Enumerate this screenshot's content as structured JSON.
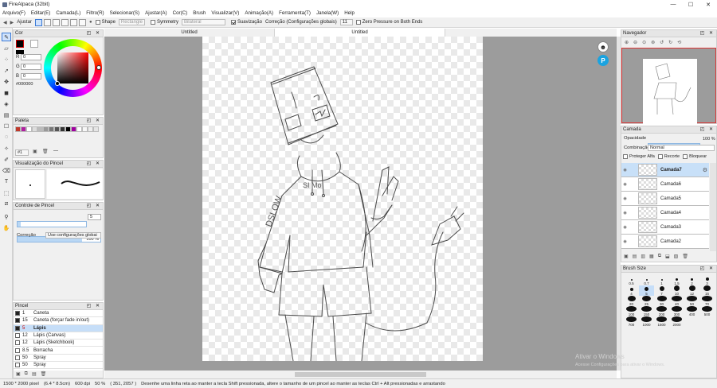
{
  "app": {
    "title": "FireAlpaca (32bit)"
  },
  "window_controls": {
    "minimize": "—",
    "maximize": "☐",
    "close": "✕"
  },
  "menu": [
    "Arquivo(F)",
    "Editar(E)",
    "Camada(L)",
    "Filtro(R)",
    "Selecionar(S)",
    "Ajustar(A)",
    "Cor(C)",
    "Brush",
    "Visualizar(V)",
    "Animação(A)",
    "Ferramenta(T)",
    "Janela(W)",
    "Help"
  ],
  "toolbar": {
    "fit_label": "Ajustar",
    "shape_label": "Shape",
    "shape_value": "Rectangle",
    "symmetry_label": "Symmetry",
    "symmetry_value": "Bilateral",
    "stabilizer_label": "Suavização",
    "correction_label": "Correção (Configurações globais)",
    "correction_value": "11",
    "zero_pressure_label": "Zero Pressure on Both Ends"
  },
  "tabs": [
    "Untitled",
    "Untitled"
  ],
  "color_panel": {
    "title": "Cor",
    "r_label": "R",
    "r": "0",
    "g_label": "G",
    "g": "0",
    "b_label": "B",
    "b": "0",
    "hex": "#000000"
  },
  "palette_panel": {
    "title": "Paleta",
    "page": "#1",
    "dash": "—",
    "colors": [
      "#c0392b",
      "#b020a0",
      "#ffffff",
      "#dddddd",
      "#bbbbbb",
      "#999999",
      "#777777",
      "#555555",
      "#333333",
      "#000000",
      "#a000a0",
      "#ffffff",
      "#f7f7f7",
      "#eeeeee",
      "#e5e5e5"
    ]
  },
  "brush_preview_panel": {
    "title": "Visualização do Pincel"
  },
  "brush_control_panel": {
    "title": "Controle de Pincel",
    "size": "5",
    "opacity": "100 %",
    "correction_label": "Correção",
    "correction_value": "Use configurações globai"
  },
  "brush_panel": {
    "title": "Pincel",
    "items": [
      {
        "size": "1",
        "name": "Caneta",
        "color": "#222222"
      },
      {
        "size": "15",
        "name": "Caneta (forçar fade in/out)",
        "color": "#222222"
      },
      {
        "size": "5",
        "name": "Lápis",
        "color": "#222222"
      },
      {
        "size": "12",
        "name": "Lápis (Canvas)",
        "color": "#ffffff"
      },
      {
        "size": "12",
        "name": "Lápis (Sketchbook)",
        "color": "#ffffff"
      },
      {
        "size": "8.5",
        "name": "Borracha",
        "color": "#ffffff"
      },
      {
        "size": "50",
        "name": "Spray",
        "color": "#ffffff"
      },
      {
        "size": "50",
        "name": "Spray",
        "color": "#ffffff"
      }
    ],
    "selected": 2
  },
  "navigator_panel": {
    "title": "Navegador"
  },
  "layer_panel": {
    "title": "Camada",
    "opacity_label": "Opacidade",
    "opacity": "100 %",
    "blend_label": "Combinação",
    "blend_value": "Normal",
    "protect_alpha": "Proteger Alfa",
    "clipping": "Recorte",
    "lock": "Bloquear",
    "layers": [
      "Camada7",
      "Camada6",
      "Camada5",
      "Camada4",
      "Camada3",
      "Camada2"
    ],
    "selected": 0
  },
  "brush_size_panel": {
    "title": "Brush Size",
    "sizes": [
      "0.5",
      "0.7",
      "1",
      "1.5",
      "2",
      "3",
      "4",
      "5",
      "7",
      "10",
      "12",
      "15",
      "20",
      "25",
      "30",
      "40",
      "50",
      "70",
      "100",
      "150",
      "200",
      "300",
      "400",
      "500",
      "700",
      "1000",
      "1500",
      "2000"
    ]
  },
  "statusbar": {
    "dims": "1500 * 2000 pixel",
    "physical": "(6.4 * 8.5cm)",
    "dpi": "600 dpi",
    "zoom": "50 %",
    "coords": "( 351, 2057 )",
    "hint": "Desenhe uma linha reta ao manter a tecla Shift pressionada, altere o tamanho de um pincel ao manter as teclas Ctrl + Alt pressionadas e arrastando"
  },
  "watermark": {
    "line1": "Ativar o Windows",
    "line2": "Acesse Configurações para ativar o Windows."
  }
}
